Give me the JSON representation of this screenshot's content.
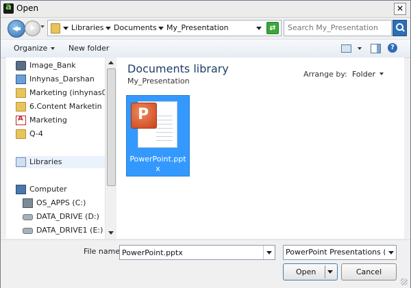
{
  "window": {
    "title": "Open",
    "close_label": "×"
  },
  "address": {
    "crumbs": [
      "Libraries",
      "Documents",
      "My_Presentation"
    ],
    "search_placeholder": "Search My_Presentation"
  },
  "toolbar": {
    "organize": "Organize",
    "new_folder": "New folder",
    "help": "?"
  },
  "nav": {
    "items": [
      {
        "label": "Image_Bank",
        "icon": "camera-icon"
      },
      {
        "label": "Inhynas_Darshan",
        "icon": "monitor-icon"
      },
      {
        "label": "Marketing (inhynas0",
        "icon": "folder-icon"
      },
      {
        "label": "6.Content Marketin",
        "icon": "folder-icon"
      },
      {
        "label": "Marketing",
        "icon": "pdf-icon"
      },
      {
        "label": "Q-4",
        "icon": "folder-icon"
      }
    ],
    "libraries": "Libraries",
    "computer": "Computer",
    "drives": [
      "OS_APPS (C:)",
      "DATA_DRIVE (D:)",
      "DATA_DRIVE1 (E:)"
    ]
  },
  "content": {
    "title": "Documents library",
    "subtitle": "My_Presentation",
    "arrange_label": "Arrange by:",
    "arrange_value": "Folder",
    "files": [
      {
        "name": "PowerPoint.pptx",
        "icon": "powerpoint-file-icon",
        "selected": true
      }
    ]
  },
  "bottom": {
    "file_name_label": "File name:",
    "file_name_value": "PowerPoint.pptx",
    "file_type": "PowerPoint Presentations (*.pp",
    "open_label": "Open",
    "cancel_label": "Cancel"
  },
  "colors": {
    "selection": "#3399ff",
    "title_blue": "#1e3d66"
  }
}
